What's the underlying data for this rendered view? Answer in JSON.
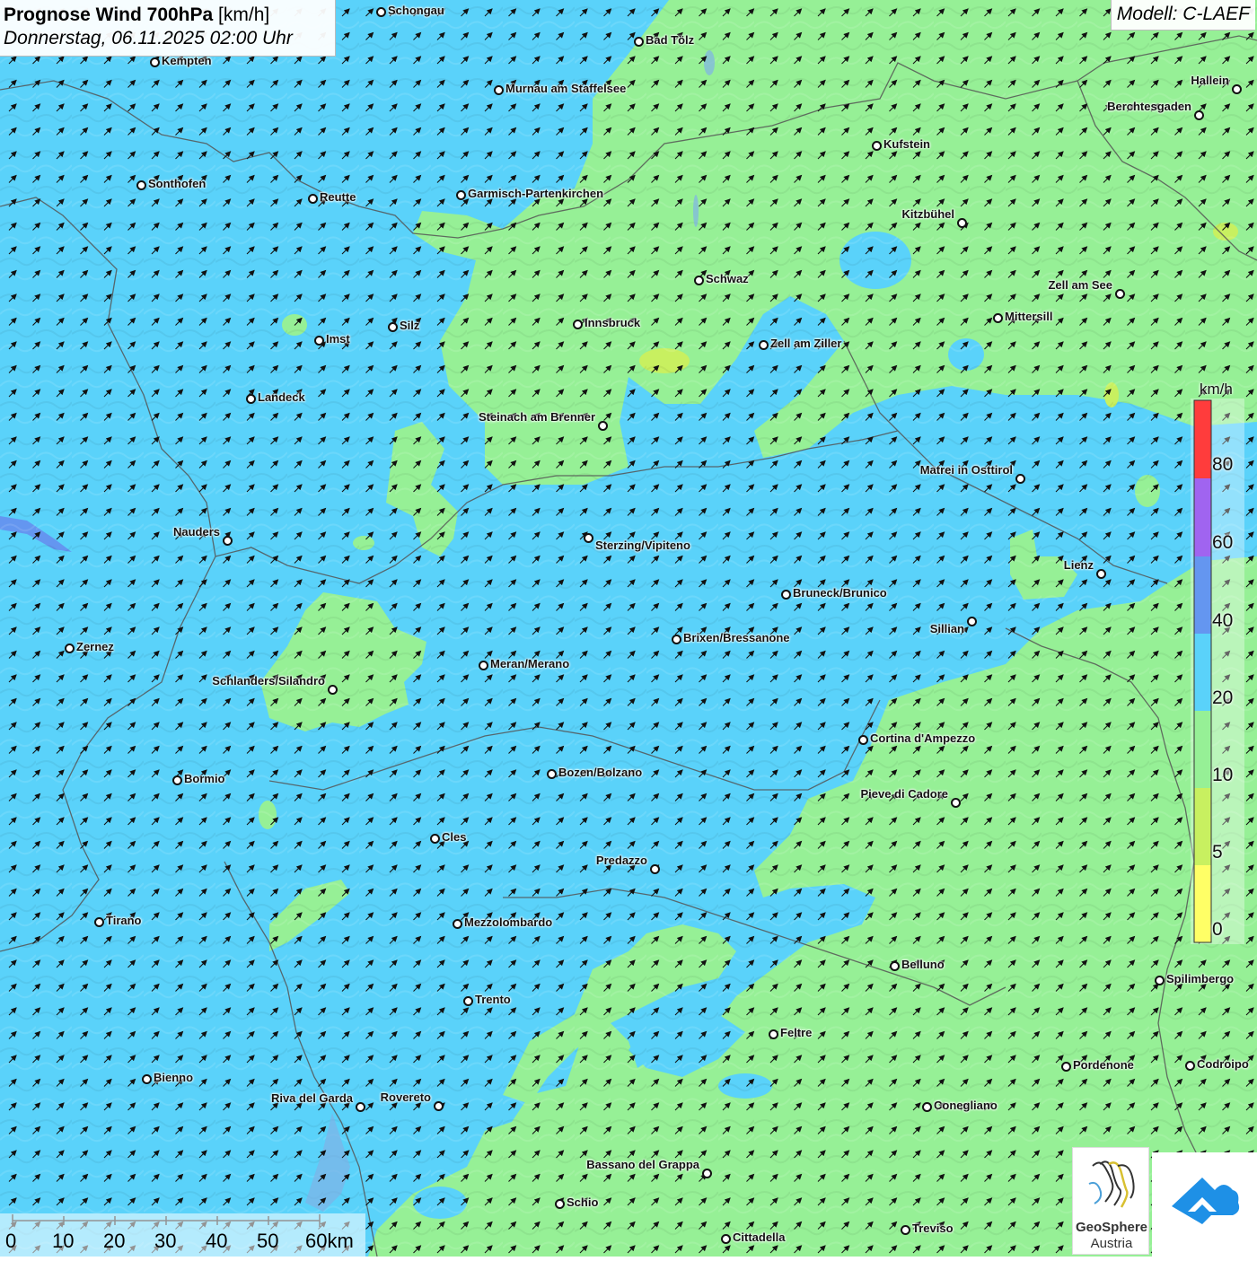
{
  "title": {
    "main": "Prognose Wind 700hPa",
    "unit": "[km/h]",
    "datetime": "Donnerstag, 06.11.2025 02:00 Uhr"
  },
  "model": "Modell: C-LAEF",
  "colors": {
    "speed_0_5": "#ffff66",
    "speed_5_10": "#c8f060",
    "speed_10_20": "#96f096",
    "speed_20_40": "#5ad2fa",
    "speed_40_60": "#6496f0",
    "speed_60_80": "#a064f0",
    "speed_80_plus": "#ff3c3c",
    "border": "#555555"
  },
  "legend": {
    "unit": "km/h",
    "ticks": [
      "80",
      "60",
      "40",
      "20",
      "10",
      "5",
      "0"
    ]
  },
  "scale_bar": {
    "labels": [
      "0",
      "10",
      "20",
      "30",
      "40",
      "50",
      "60km"
    ]
  },
  "wind": {
    "direction": "SW",
    "arrow_icon": "wind-arrow-icon"
  },
  "cities": [
    {
      "name": "Schongau"
    },
    {
      "name": "Bad Tölz"
    },
    {
      "name": "Kempten"
    },
    {
      "name": "Murnau am Staffelsee"
    },
    {
      "name": "Hallein"
    },
    {
      "name": "Berchtesgaden"
    },
    {
      "name": "Kufstein"
    },
    {
      "name": "Sonthofen"
    },
    {
      "name": "Reutte"
    },
    {
      "name": "Garmisch-Partenkirchen"
    },
    {
      "name": "Kitzbühel"
    },
    {
      "name": "Schwaz"
    },
    {
      "name": "Zell am See"
    },
    {
      "name": "Mittersill"
    },
    {
      "name": "Innsbruck"
    },
    {
      "name": "Silz"
    },
    {
      "name": "Imst"
    },
    {
      "name": "Zell am Ziller"
    },
    {
      "name": "Landeck"
    },
    {
      "name": "Steinach am Brenner"
    },
    {
      "name": "Matrei in Osttirol"
    },
    {
      "name": "Nauders"
    },
    {
      "name": "Sterzing/Vipiteno"
    },
    {
      "name": "Lienz"
    },
    {
      "name": "Bruneck/Brunico"
    },
    {
      "name": "Sillian"
    },
    {
      "name": "Zernez"
    },
    {
      "name": "Brixen/Bressanone"
    },
    {
      "name": "Meran/Merano"
    },
    {
      "name": "Schlanders/Silandro"
    },
    {
      "name": "Cortina d'Ampezzo"
    },
    {
      "name": "Bormio"
    },
    {
      "name": "Bozen/Bolzano"
    },
    {
      "name": "Pieve di Cadore"
    },
    {
      "name": "Cles"
    },
    {
      "name": "Predazzo"
    },
    {
      "name": "Tirano"
    },
    {
      "name": "Mezzolombardo"
    },
    {
      "name": "Belluno"
    },
    {
      "name": "Spilimbergo"
    },
    {
      "name": "Trento"
    },
    {
      "name": "Feltre"
    },
    {
      "name": "Pordenone"
    },
    {
      "name": "Codroipo"
    },
    {
      "name": "Bienno"
    },
    {
      "name": "Riva del Garda"
    },
    {
      "name": "Rovereto"
    },
    {
      "name": "Conegliano"
    },
    {
      "name": "Bassano del Grappa"
    },
    {
      "name": "Schio"
    },
    {
      "name": "Treviso"
    },
    {
      "name": "Cittadella"
    }
  ],
  "logos": {
    "geosphere_name": "GeoSphere",
    "geosphere_sub": "Austria"
  }
}
